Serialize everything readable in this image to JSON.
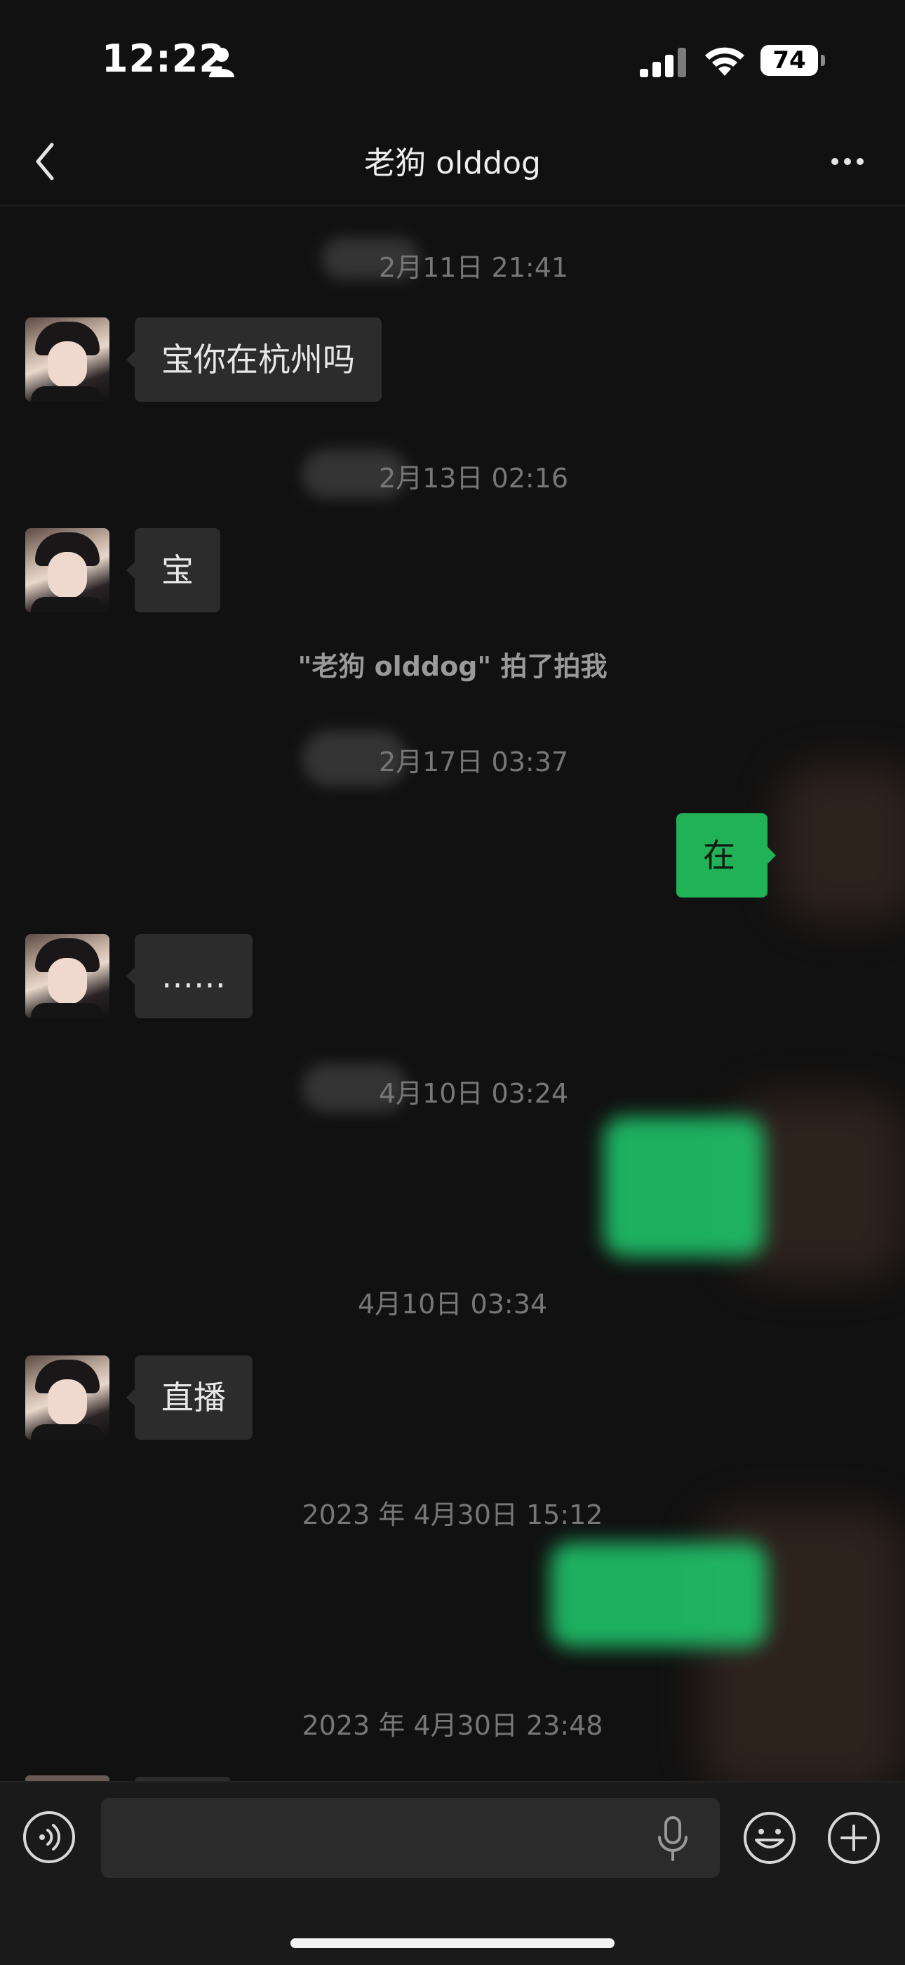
{
  "status_bar": {
    "time": "12:22",
    "battery": "74"
  },
  "header": {
    "title": "老狗 olddog"
  },
  "messages": {
    "ts1": "2月11日 21:41",
    "m1": "宝你在杭州吗",
    "ts2": "2月13日 02:16",
    "m2": "宝",
    "note": "\"老狗 olddog\" 拍了拍我",
    "ts3": "2月17日 03:37",
    "m3": "在",
    "m4": "……",
    "ts4": "4月10日 03:24",
    "ts5": "4月10日 03:34",
    "m5": "直播",
    "ts6": "2023 年 4月30日 15:12",
    "ts7": "2023 年 4月30日 23:48"
  },
  "input": {
    "placeholder": ""
  },
  "colors": {
    "accent": "#21b257",
    "background": "#111111",
    "bubble_in": "#2c2c2c"
  }
}
